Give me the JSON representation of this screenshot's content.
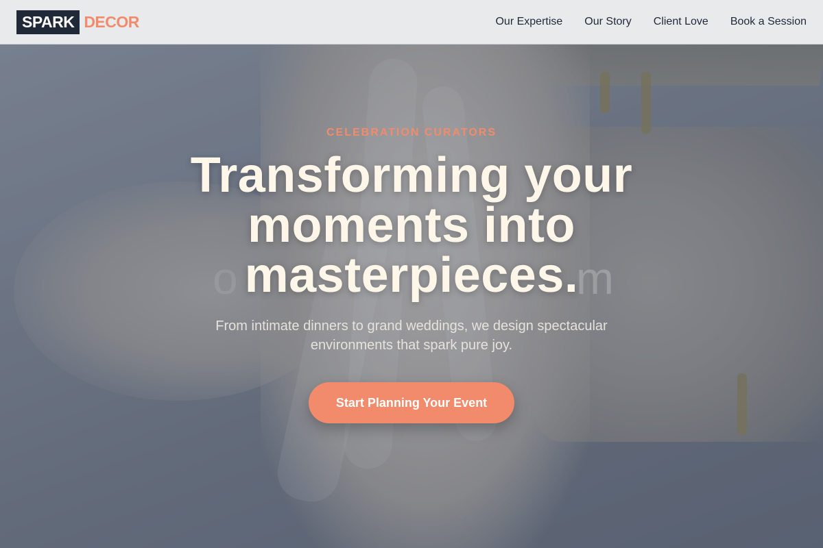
{
  "brand": {
    "name_primary": "SPARK",
    "name_accent": "DECOR",
    "colors": {
      "dark": "#1f2937",
      "accent": "#f28b6b",
      "headline": "#fdf6e9"
    }
  },
  "nav": {
    "items": [
      {
        "label": "Our Expertise"
      },
      {
        "label": "Our Story"
      },
      {
        "label": "Client Love"
      },
      {
        "label": "Book a Session"
      }
    ]
  },
  "hero": {
    "eyebrow": "CELEBRATION CURATORS",
    "headline": "Transforming your moments into masterpieces.",
    "subtext": "From intimate dinners to grand weddings, we design spectacular environments that spark pure joy.",
    "cta_label": "Start Planning Your Event"
  }
}
